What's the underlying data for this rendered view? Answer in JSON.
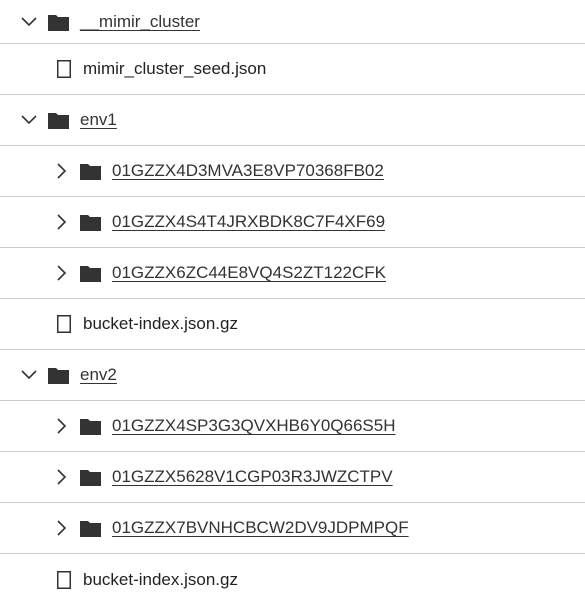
{
  "tree": {
    "rows": [
      {
        "label": "__mimir_cluster",
        "type": "folder",
        "expanded": true,
        "icon": "chevron-down-icon"
      },
      {
        "label": "mimir_cluster_seed.json",
        "type": "file"
      },
      {
        "label": "env1",
        "type": "folder",
        "expanded": true,
        "icon": "chevron-down-icon"
      },
      {
        "label": "01GZZX4D3MVA3E8VP70368FB02",
        "type": "folder",
        "expanded": false,
        "icon": "chevron-right-icon"
      },
      {
        "label": "01GZZX4S4T4JRXBDK8C7F4XF69",
        "type": "folder",
        "expanded": false,
        "icon": "chevron-right-icon"
      },
      {
        "label": "01GZZX6ZC44E8VQ4S2ZT122CFK",
        "type": "folder",
        "expanded": false,
        "icon": "chevron-right-icon"
      },
      {
        "label": "bucket-index.json.gz",
        "type": "file"
      },
      {
        "label": "env2",
        "type": "folder",
        "expanded": true,
        "icon": "chevron-down-icon"
      },
      {
        "label": "01GZZX4SP3G3QVXHB6Y0Q66S5H",
        "type": "folder",
        "expanded": false,
        "icon": "chevron-right-icon"
      },
      {
        "label": "01GZZX5628V1CGP03R3JWZCTPV",
        "type": "folder",
        "expanded": false,
        "icon": "chevron-right-icon"
      },
      {
        "label": "01GZZX7BVNHCBCW2DV9JDPMPQF",
        "type": "folder",
        "expanded": false,
        "icon": "chevron-right-icon"
      },
      {
        "label": "bucket-index.json.gz",
        "type": "file"
      }
    ]
  },
  "colors": {
    "text": "#333333",
    "icon": "#333333",
    "divider": "#cccccc",
    "background": "#ffffff"
  }
}
